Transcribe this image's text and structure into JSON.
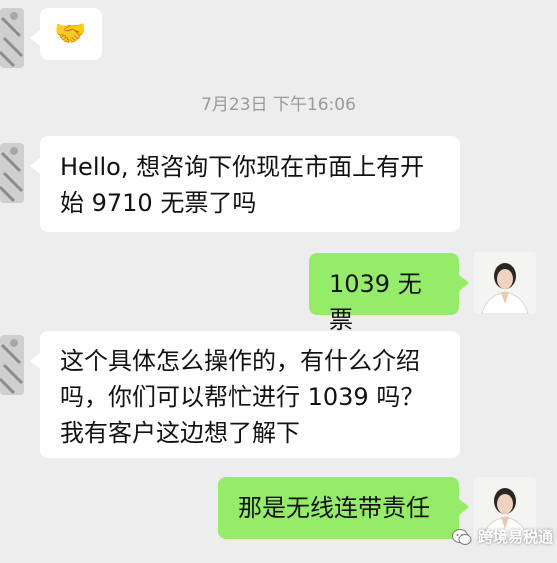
{
  "messages": [
    {
      "text": "🤝"
    },
    {
      "text": "Hello, 想咨询下你现在市面上有开始 9710 无票了吗"
    },
    {
      "text": "1039 无票"
    },
    {
      "text": "这个具体怎么操作的，有什么介绍吗，你们可以帮忙进行 1039 吗？我有客户这边想了解下"
    },
    {
      "text": "那是无线连带责任"
    }
  ],
  "timestamp": "7月23日 下午16:06",
  "watermark": "跨境易税通",
  "colors": {
    "background": "#ededed",
    "incoming_bubble": "#ffffff",
    "outgoing_bubble": "#95ec69"
  }
}
